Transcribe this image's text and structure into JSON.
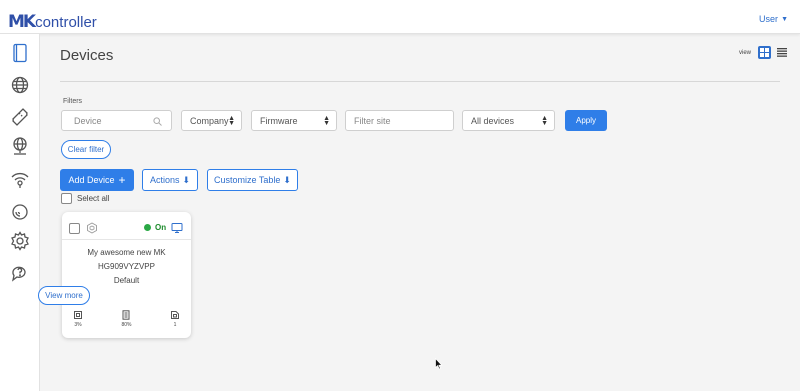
{
  "app": {
    "logo_mark": "MK",
    "logo_text": "controller"
  },
  "header": {
    "user_label": "User"
  },
  "sidebar": {
    "items": [
      {
        "name": "devices",
        "icon": "tablet-icon"
      },
      {
        "name": "sites",
        "icon": "globe-icon"
      },
      {
        "name": "licenses",
        "icon": "ticket-icon"
      },
      {
        "name": "network",
        "icon": "globe-network-icon"
      },
      {
        "name": "wireless",
        "icon": "wifi-location-icon"
      },
      {
        "name": "monitoring",
        "icon": "radar-icon"
      },
      {
        "name": "settings",
        "icon": "gear-icon"
      },
      {
        "name": "support",
        "icon": "chat-help-icon"
      }
    ]
  },
  "page": {
    "title": "Devices",
    "view_label": "view"
  },
  "filters": {
    "label": "Filters",
    "device_placeholder": "Device",
    "company_value": "Company",
    "firmware_value": "Firmware",
    "site_placeholder": "Filter site",
    "status_value": "All devices",
    "apply_label": "Apply",
    "clear_label": "Clear filter"
  },
  "toolbar": {
    "add_device_label": "Add Device",
    "actions_label": "Actions",
    "customize_label": "Customize Table",
    "select_all_label": "Select all"
  },
  "devices": [
    {
      "status": "On",
      "name": "My awesome new MK",
      "serial": "HG909VYZVPP",
      "group": "Default",
      "view_more_label": "View more",
      "cpu": "3%",
      "memory": "80%",
      "ports": "1"
    }
  ],
  "colors": {
    "accent": "#2f7ee8",
    "brand": "#2f4fa8",
    "online": "#2aa845"
  }
}
